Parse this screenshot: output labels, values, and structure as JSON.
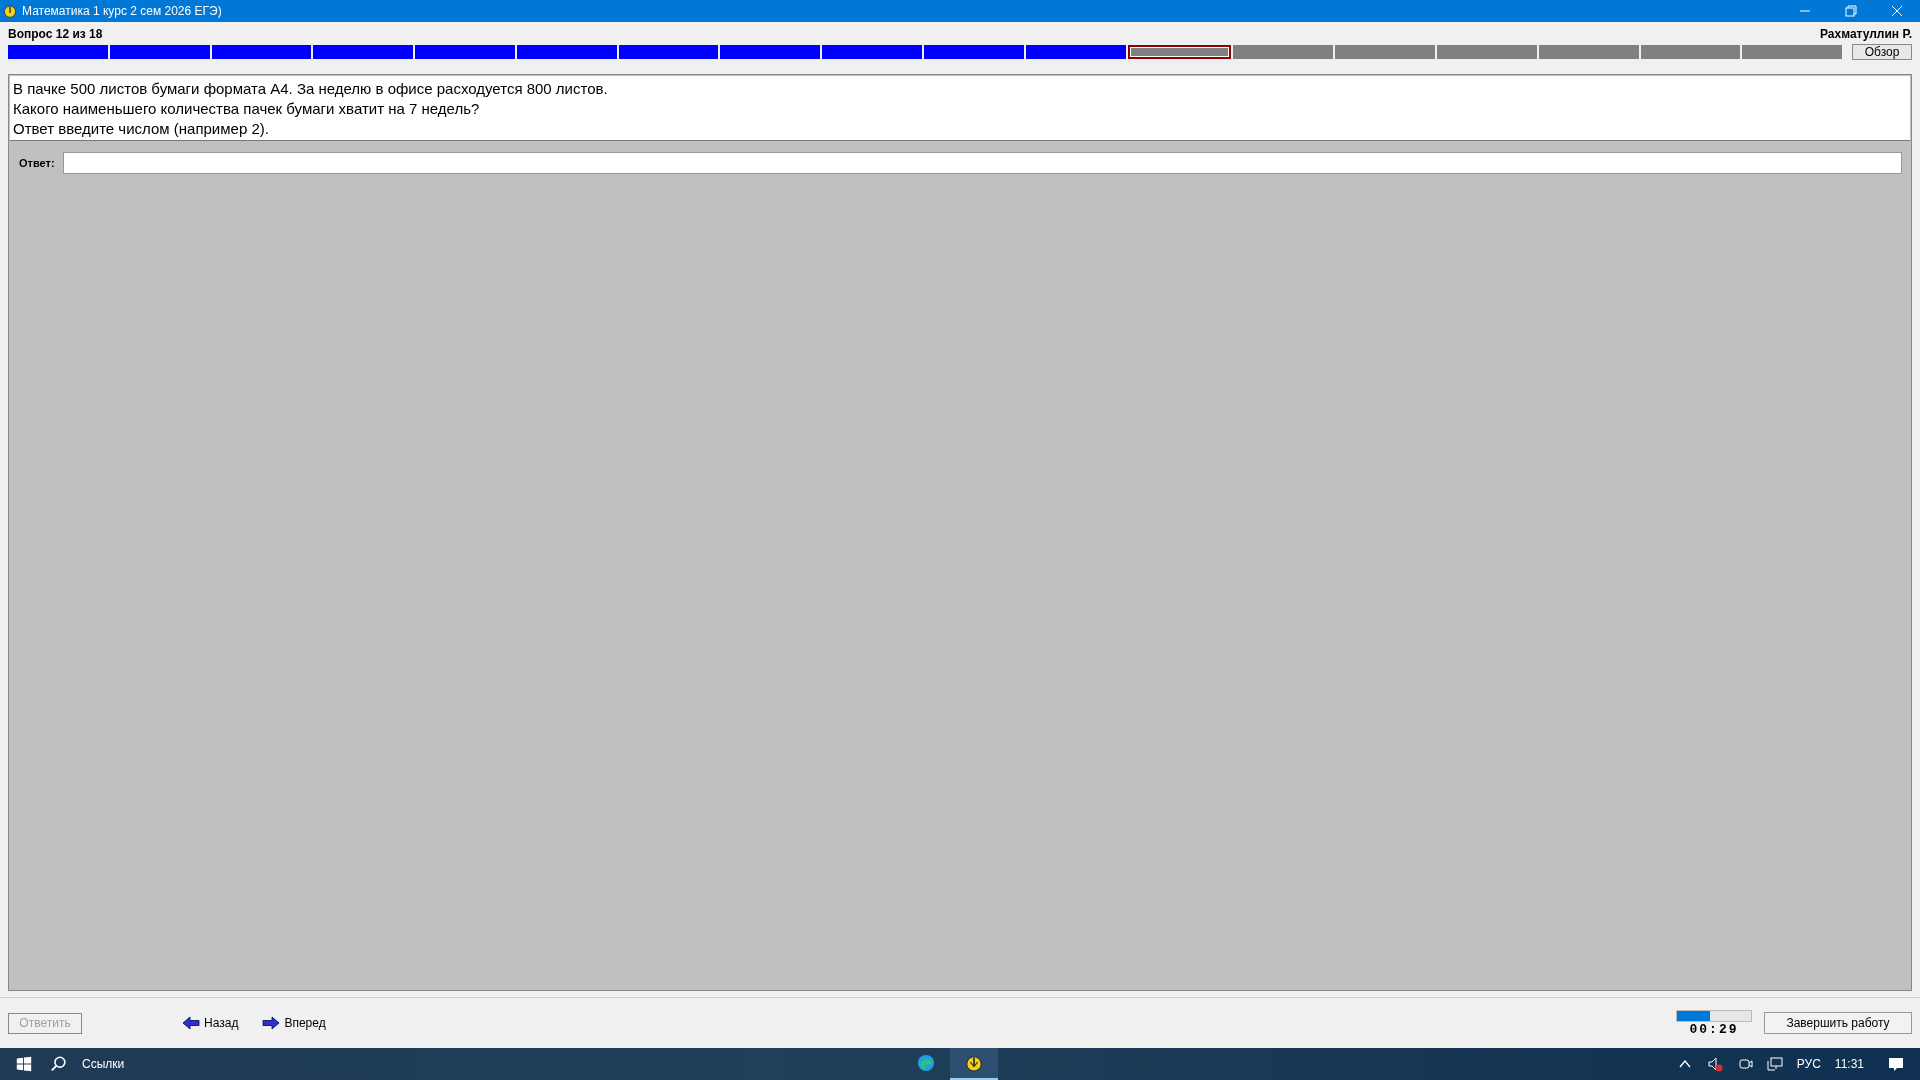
{
  "window": {
    "title": "Математика 1 курс 2 сем 2026 ЕГЭ)"
  },
  "header": {
    "question_counter": "Вопрос 12 из 18",
    "student": "Рахматуллин Р.",
    "review_button": "Обзор"
  },
  "progress": [
    {
      "answered": true,
      "selected": false
    },
    {
      "answered": true,
      "selected": false
    },
    {
      "answered": true,
      "selected": false
    },
    {
      "answered": true,
      "selected": false
    },
    {
      "answered": true,
      "selected": false
    },
    {
      "answered": true,
      "selected": false
    },
    {
      "answered": true,
      "selected": false
    },
    {
      "answered": true,
      "selected": false
    },
    {
      "answered": true,
      "selected": false
    },
    {
      "answered": true,
      "selected": false
    },
    {
      "answered": true,
      "selected": false
    },
    {
      "answered": false,
      "selected": true
    },
    {
      "answered": false,
      "selected": false
    },
    {
      "answered": false,
      "selected": false
    },
    {
      "answered": false,
      "selected": false
    },
    {
      "answered": false,
      "selected": false
    },
    {
      "answered": false,
      "selected": false
    },
    {
      "answered": false,
      "selected": false
    }
  ],
  "question": {
    "lines": [
      "В пачке 500 листов бумаги формата А4. За неделю в офисе расходуется 800 листов.",
      "Какого наименьшего количества пачек бумаги хватит на 7 недель?",
      "Ответ введите числом (например 2)."
    ]
  },
  "answer": {
    "label": "Ответ:"
  },
  "footer": {
    "submit": {
      "label": "Ответить",
      "disabled": true
    },
    "back": "Назад",
    "forward": "Вперед",
    "timer": {
      "level": 0.45,
      "reading": "00:29"
    },
    "finish": "Завершить работу"
  },
  "taskbar": {
    "search": "Ссылки",
    "apps": [
      {
        "kind": "browser",
        "active": false
      },
      {
        "kind": "test",
        "active": true
      }
    ],
    "language": "РУС",
    "time": "11:31"
  }
}
